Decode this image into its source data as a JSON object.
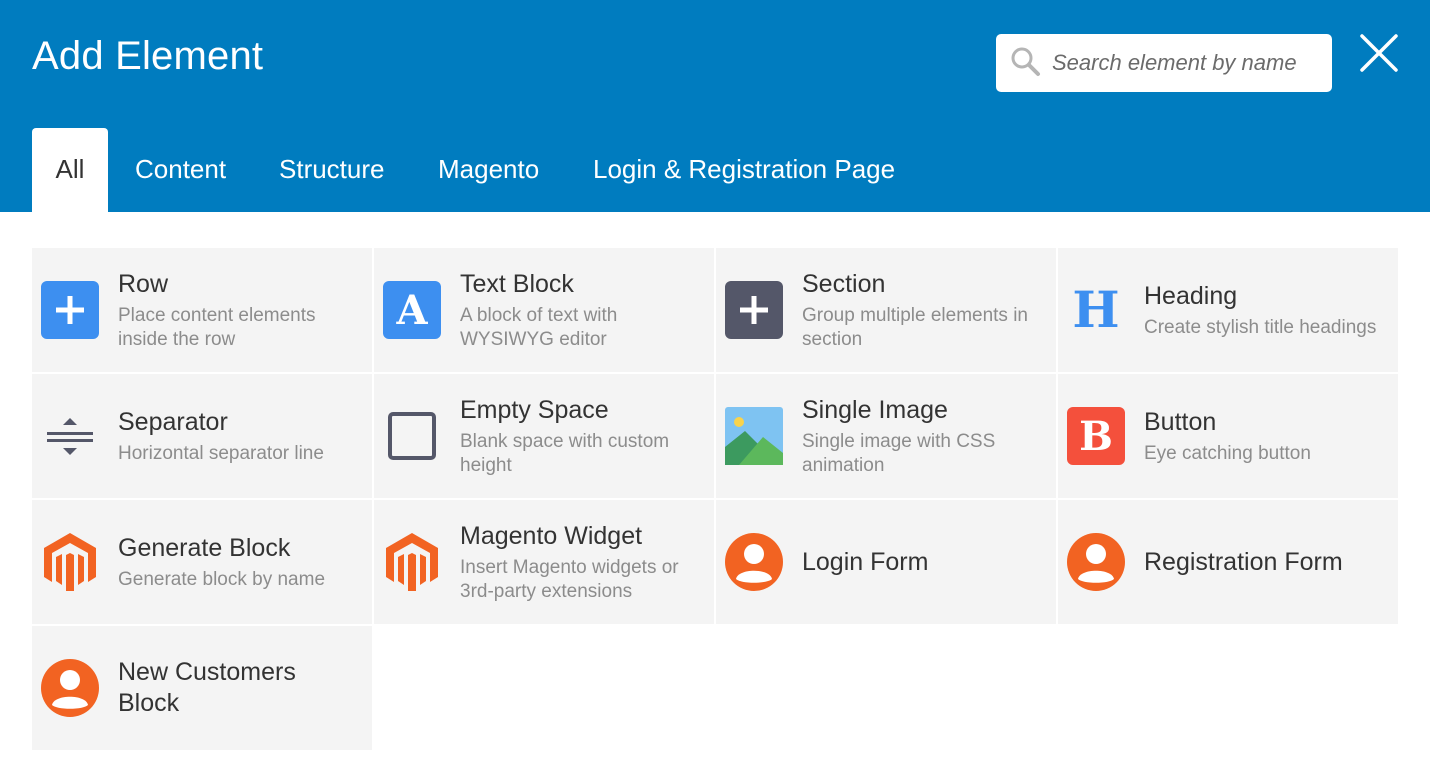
{
  "header": {
    "title": "Add Element",
    "search_placeholder": "Search element by name"
  },
  "tabs": [
    {
      "label": "All",
      "active": true
    },
    {
      "label": "Content",
      "active": false
    },
    {
      "label": "Structure",
      "active": false
    },
    {
      "label": "Magento",
      "active": false
    },
    {
      "label": "Login & Registration Page",
      "active": false
    }
  ],
  "elements": [
    {
      "name": "Row",
      "description": "Place content elements inside the row",
      "icon": "plus-icon"
    },
    {
      "name": "Text Block",
      "description": "A block of text with WYSIWYG editor",
      "icon": "text-a-icon"
    },
    {
      "name": "Section",
      "description": "Group multiple elements in section",
      "icon": "plus-icon"
    },
    {
      "name": "Heading",
      "description": "Create stylish title headings",
      "icon": "heading-h-icon"
    },
    {
      "name": "Separator",
      "description": "Horizontal separator line",
      "icon": "separator-icon"
    },
    {
      "name": "Empty Space",
      "description": "Blank space with custom height",
      "icon": "empty-square-icon"
    },
    {
      "name": "Single Image",
      "description": "Single image with CSS animation",
      "icon": "image-icon"
    },
    {
      "name": "Button",
      "description": "Eye catching button",
      "icon": "button-b-icon"
    },
    {
      "name": "Generate Block",
      "description": "Generate block by name",
      "icon": "magento-icon"
    },
    {
      "name": "Magento Widget",
      "description": "Insert Magento widgets or 3rd-party extensions",
      "icon": "magento-icon"
    },
    {
      "name": "Login Form",
      "description": "",
      "icon": "user-icon"
    },
    {
      "name": "Registration Form",
      "description": "",
      "icon": "user-icon"
    },
    {
      "name": "New Customers Block",
      "description": "",
      "icon": "user-icon"
    }
  ],
  "icons": {
    "glyph_a": "A",
    "glyph_h": "H",
    "glyph_b": "B"
  },
  "colors": {
    "header": "#007cbf",
    "row_icon": "#3d8ff0",
    "section_icon": "#545769",
    "heading_icon": "#3d8ff0",
    "button_icon": "#f4503c",
    "magento_icon": "#f26322",
    "user_icon": "#f26322"
  }
}
